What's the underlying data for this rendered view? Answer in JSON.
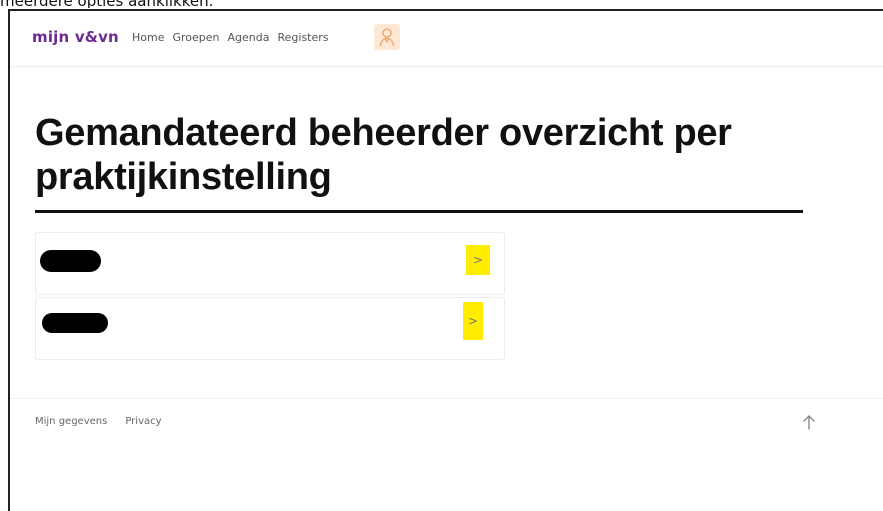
{
  "caption": "meerdere opties aanklikken.",
  "header": {
    "logo": "mijn v&vn",
    "nav": [
      {
        "label": "Home"
      },
      {
        "label": "Groepen"
      },
      {
        "label": "Agenda"
      },
      {
        "label": "Registers"
      }
    ],
    "avatar_icon": "user-icon"
  },
  "main": {
    "title": "Gemandateerd beheerder overzicht per praktijkinstelling",
    "items": [
      {
        "label": "",
        "redacted": true,
        "action_icon": "chevron-right-icon",
        "action_label": ">"
      },
      {
        "label": "",
        "redacted": true,
        "action_icon": "chevron-right-icon",
        "action_label": ">"
      }
    ]
  },
  "footer": {
    "links": [
      {
        "label": "Mijn gegevens"
      },
      {
        "label": "Privacy"
      }
    ],
    "back_to_top_icon": "arrow-up-icon"
  },
  "colors": {
    "brand": "#6b2c91",
    "highlight": "#ffec00",
    "text": "#111111"
  }
}
